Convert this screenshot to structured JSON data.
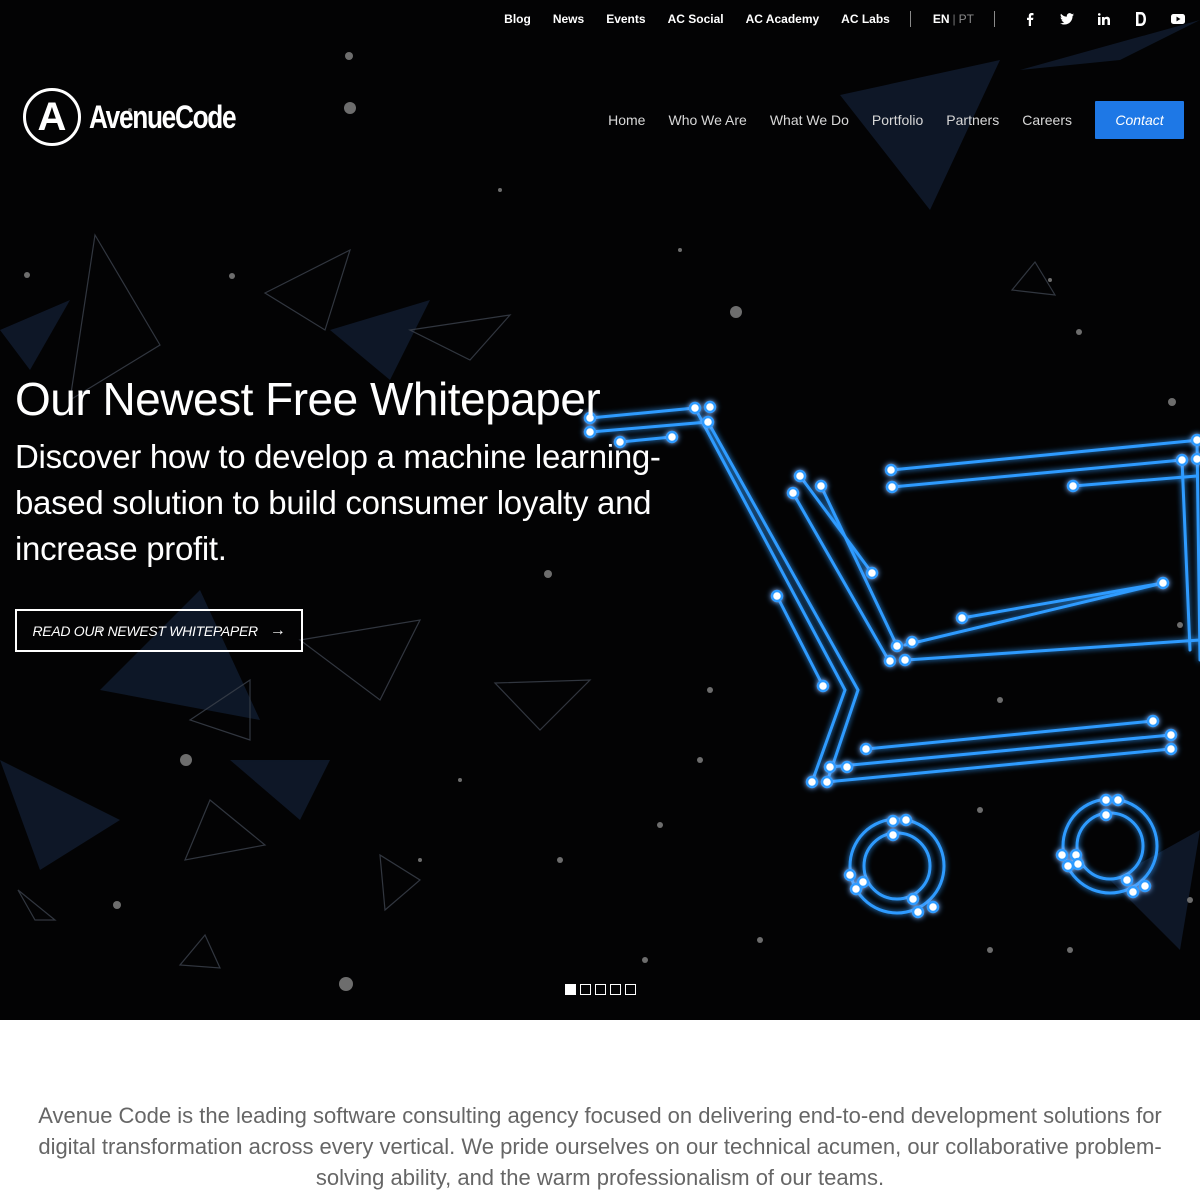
{
  "utility_nav": {
    "links": [
      "Blog",
      "News",
      "Events",
      "AC Social",
      "AC Academy",
      "AC Labs"
    ],
    "lang_active": "EN",
    "lang_sep": "|",
    "lang_other": "PT",
    "social_icons": [
      "facebook-icon",
      "twitter-icon",
      "linkedin-icon",
      "medium-icon",
      "youtube-icon"
    ]
  },
  "logo": {
    "mark": "A",
    "text": "AvenueCode"
  },
  "main_nav": {
    "links": [
      "Home",
      "Who We Are",
      "What We Do",
      "Portfolio",
      "Partners",
      "Careers"
    ],
    "contact_label": "Contact"
  },
  "hero": {
    "title": "Our Newest Free Whitepaper",
    "subtitle": "Discover how to develop a machine learning-based solution to build consumer loyalty and increase profit.",
    "cta_label": "READ OUR NEWEST WHITEPAPER",
    "cta_arrow": "→",
    "slide_count": 5,
    "active_slide": 1
  },
  "about": {
    "text": "Avenue Code is the leading software consulting agency focused on delivering end-to-end development solutions for digital transformation across every vertical. We pride ourselves on our technical acumen, our collaborative problem-solving ability, and the warm professionalism of our teams."
  },
  "colors": {
    "hero_bg": "#030304",
    "accent": "#1e78e6",
    "glow": "#2f9bff"
  }
}
